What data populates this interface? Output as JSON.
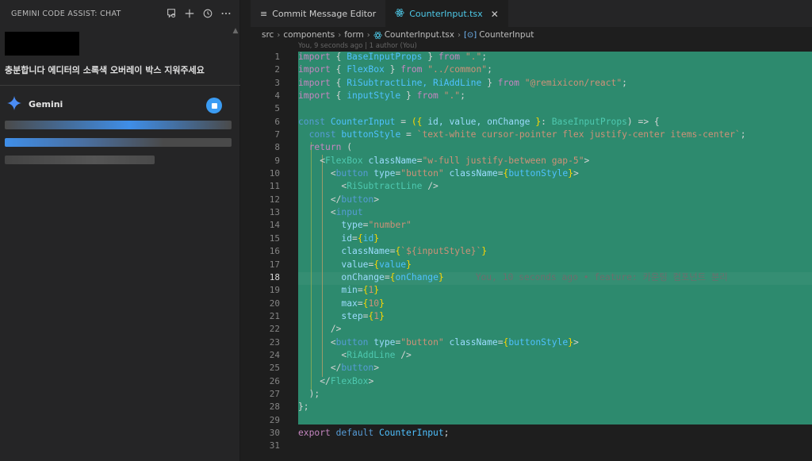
{
  "chat_panel": {
    "title": "GEMINI CODE ASSIST: CHAT",
    "user_message": "충분합니다 에디터의 소록색 오버레이 박스 지워주세요",
    "assistant_name": "Gemini"
  },
  "tabs": [
    {
      "label": "Commit Message Editor",
      "active": false
    },
    {
      "label": "CounterInput.tsx",
      "active": true
    }
  ],
  "breadcrumb": [
    "src",
    "components",
    "form",
    "CounterInput.tsx",
    "CounterInput"
  ],
  "blame_header": "You, 9 seconds ago | 1 author (You)",
  "current_line_blame": "You, 10 seconds ago • feature: 카운팅 컴포넌트 분리",
  "line_numbers": [
    "1",
    "2",
    "3",
    "4",
    "5",
    "6",
    "7",
    "8",
    "9",
    "10",
    "11",
    "12",
    "13",
    "14",
    "15",
    "16",
    "17",
    "18",
    "19",
    "20",
    "21",
    "22",
    "23",
    "24",
    "25",
    "26",
    "27",
    "28",
    "29",
    "30",
    "31"
  ],
  "colors": {
    "selection_overlay": "#2d8a6e",
    "accent": "#3b9cf3",
    "active_tab_text": "#4ec9e8"
  },
  "code": {
    "l1": [
      "import",
      " { ",
      "BaseInputProps",
      " } ",
      "from",
      " \".\"",
      ";"
    ],
    "l2": [
      "import",
      " { ",
      "FlexBox",
      " } ",
      "from",
      " \"../common\"",
      ";"
    ],
    "l3": [
      "import",
      " { ",
      "RiSubtractLine, RiAddLine",
      " } ",
      "from",
      " \"@remixicon/react\"",
      ";"
    ],
    "l4": [
      "import",
      " { ",
      "inputStyle",
      " } ",
      "from",
      " \".\"",
      ";"
    ],
    "l6": [
      "const",
      " CounterInput",
      " = ",
      "({",
      " id, value, onChange ",
      "}",
      ": ",
      "BaseInputProps",
      ") => {"
    ],
    "l7": [
      "const",
      " buttonStyle",
      " = ",
      "`text-white cursor-pointer flex justify-center items-center`",
      ";"
    ],
    "l8": [
      "return",
      " ("
    ],
    "l9": [
      "<",
      "FlexBox",
      " className",
      "=",
      "\"w-full justify-between gap-5\"",
      ">"
    ],
    "l10": [
      "<",
      "button",
      " type",
      "=",
      "\"button\"",
      " className",
      "=",
      "{",
      "buttonStyle",
      "}",
      ">"
    ],
    "l11": [
      "<",
      "RiSubtractLine",
      " />"
    ],
    "l12": [
      "</",
      "button",
      ">"
    ],
    "l13": [
      "<",
      "input"
    ],
    "l14": [
      "type",
      "=",
      "\"number\""
    ],
    "l15": [
      "id",
      "=",
      "{",
      "id",
      "}"
    ],
    "l16": [
      "className",
      "=",
      "{",
      "`${inputStyle}`",
      "}"
    ],
    "l17": [
      "value",
      "=",
      "{",
      "value",
      "}"
    ],
    "l18": [
      "onChange",
      "=",
      "{",
      "onChange",
      "}"
    ],
    "l19": [
      "min",
      "=",
      "{",
      "1",
      "}"
    ],
    "l20": [
      "max",
      "=",
      "{",
      "10",
      "}"
    ],
    "l21": [
      "step",
      "=",
      "{",
      "1",
      "}"
    ],
    "l22": [
      "/>"
    ],
    "l23": [
      "<",
      "button",
      " type",
      "=",
      "\"button\"",
      " className",
      "=",
      "{",
      "buttonStyle",
      "}",
      ">"
    ],
    "l24": [
      "<",
      "RiAddLine",
      " />"
    ],
    "l25": [
      "</",
      "button",
      ">"
    ],
    "l26": [
      "</",
      "FlexBox",
      ">"
    ],
    "l27": [
      ");"
    ],
    "l28": [
      "};"
    ],
    "l30": [
      "export",
      " default",
      " CounterInput",
      ";"
    ]
  }
}
